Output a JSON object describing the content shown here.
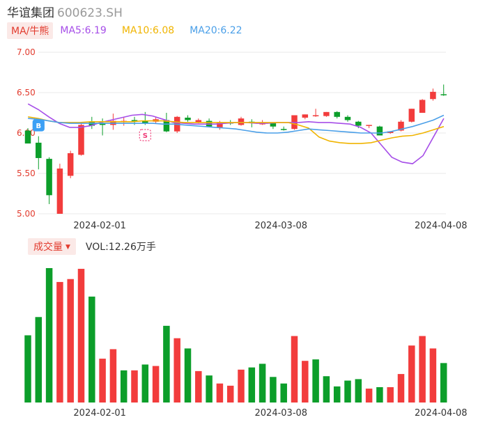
{
  "header": {
    "name": "华谊集团",
    "code": "600623.SH"
  },
  "ma_legend": {
    "tag": "MA/牛熊",
    "items": [
      {
        "label": "MA5:6.19",
        "color": "#a64ee8"
      },
      {
        "label": "MA10:6.08",
        "color": "#f0b400"
      },
      {
        "label": "MA20:6.22",
        "color": "#4a9fe8"
      }
    ]
  },
  "volume_legend": {
    "tag": "成交量",
    "value": "VOL:12.26万手"
  },
  "markers": [
    {
      "symbol": "B",
      "icon": "buy-signal-icon",
      "color": "#3da0f5",
      "day": 1
    },
    {
      "symbol": "S",
      "icon": "sell-signal-icon",
      "color": "#f03c78",
      "day": 11
    }
  ],
  "colors": {
    "up": "#f23c3c",
    "down": "#0c9e2a",
    "grid": "#e8e8e8",
    "axis_text": "#e23b2e",
    "date_text": "#333333"
  },
  "chart_data": [
    {
      "type": "candlestick",
      "y_ticks": [
        "7.00",
        "6.50",
        "6.00",
        "5.50",
        "5.00"
      ],
      "ylim": [
        5.0,
        7.0
      ],
      "x_labels": [
        {
          "day": 4,
          "text": "2024-02-01"
        },
        {
          "day": 21,
          "text": "2024-03-08"
        },
        {
          "day": 36,
          "text": "2024-04-08"
        }
      ],
      "candles": [
        {
          "o": 6.03,
          "h": 6.06,
          "l": 5.88,
          "c": 5.87,
          "up": false
        },
        {
          "o": 5.88,
          "h": 5.96,
          "l": 5.55,
          "c": 5.69,
          "up": false
        },
        {
          "o": 5.68,
          "h": 5.7,
          "l": 5.12,
          "c": 5.23,
          "up": false
        },
        {
          "o": 5.0,
          "h": 5.62,
          "l": 4.99,
          "c": 5.56,
          "up": true
        },
        {
          "o": 5.47,
          "h": 5.78,
          "l": 5.44,
          "c": 5.75,
          "up": true
        },
        {
          "o": 5.73,
          "h": 6.13,
          "l": 5.72,
          "c": 6.1,
          "up": true
        },
        {
          "o": 6.09,
          "h": 6.2,
          "l": 6.05,
          "c": 6.14,
          "up": false
        },
        {
          "o": 6.12,
          "h": 6.18,
          "l": 5.97,
          "c": 6.1,
          "up": false
        },
        {
          "o": 6.1,
          "h": 6.24,
          "l": 6.04,
          "c": 6.15,
          "up": true
        },
        {
          "o": 6.14,
          "h": 6.19,
          "l": 6.09,
          "c": 6.15,
          "up": true
        },
        {
          "o": 6.15,
          "h": 6.2,
          "l": 6.1,
          "c": 6.16,
          "up": false
        },
        {
          "o": 6.15,
          "h": 6.26,
          "l": 6.1,
          "c": 6.12,
          "up": false
        },
        {
          "o": 6.17,
          "h": 6.2,
          "l": 6.12,
          "c": 6.14,
          "up": true
        },
        {
          "o": 6.16,
          "h": 6.25,
          "l": 6.01,
          "c": 6.02,
          "up": false
        },
        {
          "o": 6.2,
          "h": 6.21,
          "l": 6.0,
          "c": 6.02,
          "up": true
        },
        {
          "o": 6.19,
          "h": 6.22,
          "l": 6.14,
          "c": 6.16,
          "up": false
        },
        {
          "o": 6.13,
          "h": 6.18,
          "l": 6.12,
          "c": 6.16,
          "up": true
        },
        {
          "o": 6.15,
          "h": 6.18,
          "l": 6.07,
          "c": 6.08,
          "up": false
        },
        {
          "o": 6.13,
          "h": 6.15,
          "l": 6.04,
          "c": 6.07,
          "up": true
        },
        {
          "o": 6.13,
          "h": 6.16,
          "l": 6.1,
          "c": 6.12,
          "up": false
        },
        {
          "o": 6.18,
          "h": 6.2,
          "l": 6.09,
          "c": 6.1,
          "up": true
        },
        {
          "o": 6.14,
          "h": 6.17,
          "l": 6.07,
          "c": 6.13,
          "up": false
        },
        {
          "o": 6.11,
          "h": 6.16,
          "l": 6.1,
          "c": 6.12,
          "up": true
        },
        {
          "o": 6.12,
          "h": 6.13,
          "l": 6.05,
          "c": 6.08,
          "up": false
        },
        {
          "o": 6.05,
          "h": 6.08,
          "l": 6.03,
          "c": 6.05,
          "up": false
        },
        {
          "o": 6.05,
          "h": 6.22,
          "l": 6.04,
          "c": 6.22,
          "up": true
        },
        {
          "o": 6.19,
          "h": 6.23,
          "l": 6.17,
          "c": 6.23,
          "up": true
        },
        {
          "o": 6.21,
          "h": 6.3,
          "l": 6.2,
          "c": 6.22,
          "up": true
        },
        {
          "o": 6.21,
          "h": 6.26,
          "l": 6.2,
          "c": 6.26,
          "up": true
        },
        {
          "o": 6.26,
          "h": 6.27,
          "l": 6.18,
          "c": 6.2,
          "up": false
        },
        {
          "o": 6.2,
          "h": 6.22,
          "l": 6.14,
          "c": 6.16,
          "up": false
        },
        {
          "o": 6.14,
          "h": 6.15,
          "l": 6.06,
          "c": 6.09,
          "up": false
        },
        {
          "o": 6.09,
          "h": 6.1,
          "l": 6.06,
          "c": 6.1,
          "up": true
        },
        {
          "o": 6.08,
          "h": 6.09,
          "l": 5.97,
          "c": 5.97,
          "up": false
        },
        {
          "o": 6.0,
          "h": 6.02,
          "l": 5.99,
          "c": 6.02,
          "up": true
        },
        {
          "o": 6.03,
          "h": 6.16,
          "l": 6.02,
          "c": 6.14,
          "up": true
        },
        {
          "o": 6.14,
          "h": 6.3,
          "l": 6.13,
          "c": 6.3,
          "up": true
        },
        {
          "o": 6.25,
          "h": 6.42,
          "l": 6.25,
          "c": 6.41,
          "up": true
        },
        {
          "o": 6.42,
          "h": 6.55,
          "l": 6.4,
          "c": 6.51,
          "up": true
        },
        {
          "o": 6.48,
          "h": 6.6,
          "l": 6.46,
          "c": 6.47,
          "up": false
        }
      ],
      "ma5": [
        6.36,
        6.29,
        6.2,
        6.12,
        6.07,
        6.07,
        6.09,
        6.13,
        6.16,
        6.19,
        6.22,
        6.23,
        6.21,
        6.17,
        6.13,
        6.12,
        6.11,
        6.11,
        6.11,
        6.12,
        6.13,
        6.13,
        6.12,
        6.12,
        6.13,
        6.13,
        6.13,
        6.14,
        6.13,
        6.13,
        6.12,
        6.11,
        6.07,
        6.0,
        5.85,
        5.7,
        5.64,
        5.62,
        5.72,
        5.95,
        6.18
      ],
      "ma10": [
        6.2,
        6.18,
        6.15,
        6.13,
        6.13,
        6.13,
        6.14,
        6.14,
        6.14,
        6.14,
        6.14,
        6.15,
        6.15,
        6.15,
        6.14,
        6.13,
        6.13,
        6.13,
        6.13,
        6.13,
        6.13,
        6.13,
        6.13,
        6.13,
        6.13,
        6.13,
        6.1,
        6.06,
        5.95,
        5.9,
        5.88,
        5.87,
        5.87,
        5.88,
        5.91,
        5.94,
        5.96,
        5.97,
        6.0,
        6.04,
        6.08
      ],
      "ma20": [
        6.18,
        6.17,
        6.15,
        6.13,
        6.12,
        6.12,
        6.12,
        6.12,
        6.12,
        6.12,
        6.12,
        6.12,
        6.12,
        6.11,
        6.11,
        6.1,
        6.09,
        6.08,
        6.07,
        6.06,
        6.05,
        6.03,
        6.01,
        6.0,
        6.0,
        6.01,
        6.03,
        6.05,
        6.04,
        6.03,
        6.02,
        6.01,
        6.0,
        6.0,
        6.0,
        6.02,
        6.05,
        6.08,
        6.12,
        6.16,
        6.22
      ]
    },
    {
      "type": "bar",
      "unit": "万手",
      "volumes": [
        {
          "v": 9.2,
          "up": false
        },
        {
          "v": 11.7,
          "up": false
        },
        {
          "v": 18.4,
          "up": false
        },
        {
          "v": 16.5,
          "up": true
        },
        {
          "v": 16.9,
          "up": true
        },
        {
          "v": 18.3,
          "up": true
        },
        {
          "v": 14.5,
          "up": false
        },
        {
          "v": 6.0,
          "up": true
        },
        {
          "v": 7.3,
          "up": true
        },
        {
          "v": 4.4,
          "up": false
        },
        {
          "v": 4.4,
          "up": true
        },
        {
          "v": 5.2,
          "up": false
        },
        {
          "v": 5.0,
          "up": true
        },
        {
          "v": 10.5,
          "up": false
        },
        {
          "v": 8.8,
          "up": true
        },
        {
          "v": 7.4,
          "up": false
        },
        {
          "v": 4.3,
          "up": true
        },
        {
          "v": 3.7,
          "up": false
        },
        {
          "v": 2.6,
          "up": true
        },
        {
          "v": 2.3,
          "up": true
        },
        {
          "v": 4.5,
          "up": true
        },
        {
          "v": 4.8,
          "up": false
        },
        {
          "v": 5.3,
          "up": false
        },
        {
          "v": 3.5,
          "up": false
        },
        {
          "v": 2.6,
          "up": false
        },
        {
          "v": 9.1,
          "up": true
        },
        {
          "v": 5.7,
          "up": true
        },
        {
          "v": 5.9,
          "up": false
        },
        {
          "v": 3.6,
          "up": false
        },
        {
          "v": 2.2,
          "up": false
        },
        {
          "v": 3.0,
          "up": false
        },
        {
          "v": 3.2,
          "up": false
        },
        {
          "v": 1.9,
          "up": true
        },
        {
          "v": 2.1,
          "up": false
        },
        {
          "v": 2.1,
          "up": true
        },
        {
          "v": 3.9,
          "up": true
        },
        {
          "v": 7.8,
          "up": true
        },
        {
          "v": 9.1,
          "up": true
        },
        {
          "v": 7.4,
          "up": true
        },
        {
          "v": 5.4,
          "up": false
        }
      ]
    }
  ]
}
